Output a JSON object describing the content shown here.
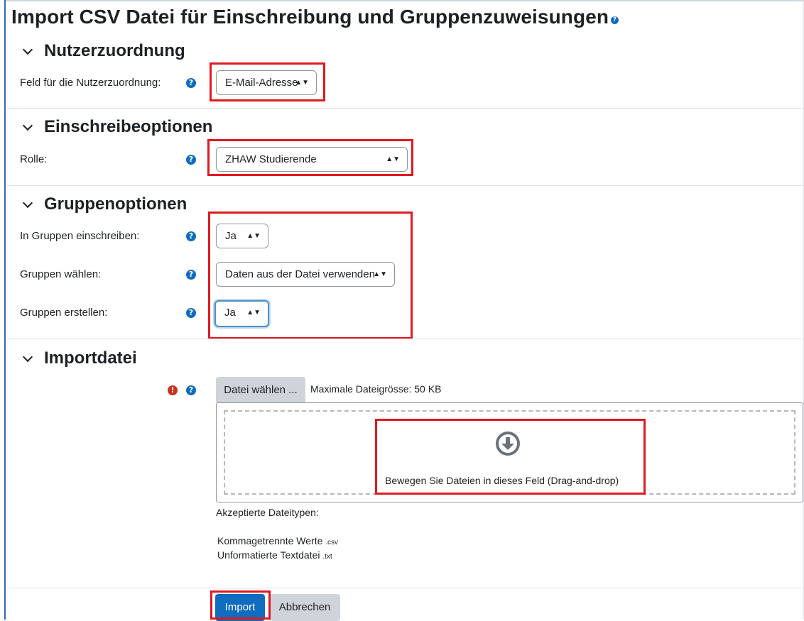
{
  "title": "Import CSV Datei für Einschreibung und Gruppenzuweisungen",
  "sections": {
    "user_mapping": {
      "heading": "Nutzerzuordnung",
      "field_label": "Feld für die Nutzerzuordnung:",
      "field_value": "E-Mail-Adresse"
    },
    "enrol_options": {
      "heading": "Einschreibeoptionen",
      "role_label": "Rolle:",
      "role_value": "ZHAW Studierende"
    },
    "group_options": {
      "heading": "Gruppenoptionen",
      "enrol_in_groups_label": "In Gruppen einschreiben:",
      "enrol_in_groups_value": "Ja",
      "choose_groups_label": "Gruppen wählen:",
      "choose_groups_value": "Daten aus der Datei verwenden",
      "create_groups_label": "Gruppen erstellen:",
      "create_groups_value": "Ja"
    },
    "import_file": {
      "heading": "Importdatei",
      "choose_file_label": "Datei wählen ...",
      "max_size": "Maximale Dateigrösse: 50 KB",
      "dropzone_text": "Bewegen Sie Dateien in dieses Feld (Drag-and-drop)",
      "accepted_label": "Akzeptierte Dateitypen:",
      "file_types": [
        {
          "name": "Kommagetrennte Werte",
          "ext": ".csv"
        },
        {
          "name": "Unformatierte Textdatei",
          "ext": ".txt"
        }
      ]
    }
  },
  "buttons": {
    "import": "Import",
    "cancel": "Abbrechen"
  },
  "icons": {
    "help": "question-circle-icon",
    "required": "exclamation-circle-icon",
    "collapse": "chevron-down-icon",
    "upload": "arrow-circle-down-icon"
  },
  "colors": {
    "primary": "#0f6cbf",
    "highlight": "#e0191f",
    "required": "#ca3120",
    "focus": "#4a90c9"
  }
}
